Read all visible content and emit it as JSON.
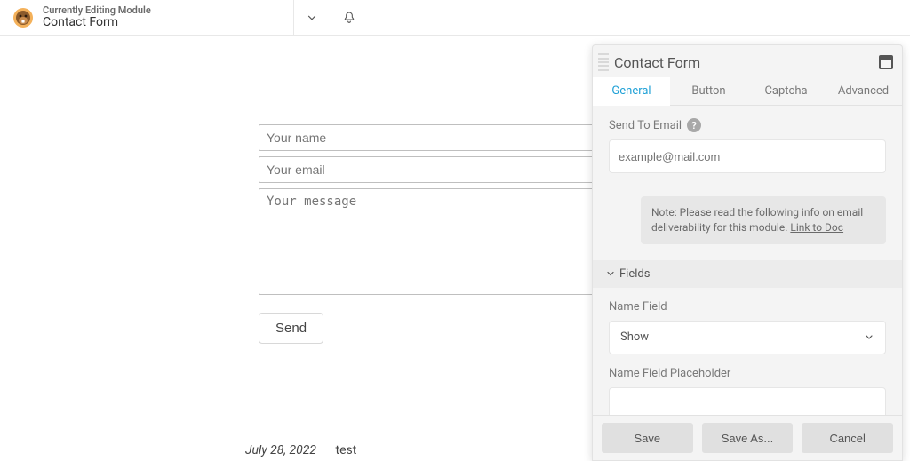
{
  "topbar": {
    "editing_label": "Currently Editing Module",
    "module_name": "Contact Form"
  },
  "preview": {
    "name_placeholder": "Your name",
    "email_placeholder": "Your email",
    "message_placeholder": "Your message",
    "send_label": "Send"
  },
  "meta": {
    "date": "July 28, 2022",
    "text": "test"
  },
  "panel": {
    "title": "Contact Form",
    "tabs": {
      "general": "General",
      "button": "Button",
      "captcha": "Captcha",
      "advanced": "Advanced"
    },
    "send_to_label": "Send To Email",
    "send_to_placeholder": "example@mail.com",
    "note_text": "Note: Please read the following info on email deliverability for this module. ",
    "note_link": "Link to Doc",
    "fields_section": "Fields",
    "name_field_label": "Name Field",
    "name_field_value": "Show",
    "name_placeholder_label": "Name Field Placeholder",
    "footer": {
      "save": "Save",
      "save_as": "Save As...",
      "cancel": "Cancel"
    }
  }
}
